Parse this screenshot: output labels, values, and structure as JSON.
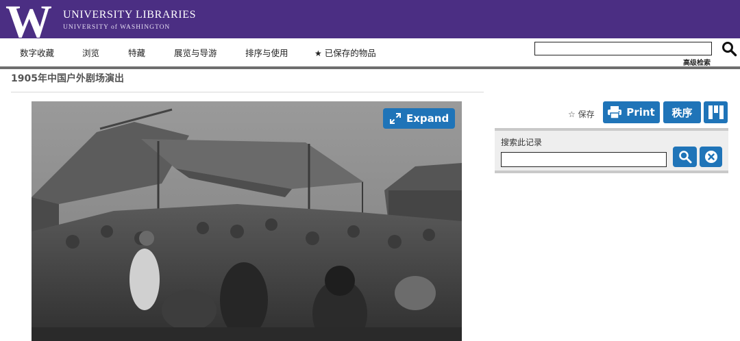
{
  "header": {
    "logo_letter": "W",
    "title": "UNIVERSITY LIBRARIES",
    "subtitle": "UNIVERSITY of WASHINGTON",
    "brand_color": "#4b2e83"
  },
  "nav": {
    "items": [
      {
        "label": "数字收藏"
      },
      {
        "label": "浏览"
      },
      {
        "label": "特藏"
      },
      {
        "label": "展览与导游"
      },
      {
        "label": "排序与使用"
      },
      {
        "label": "已保存的物品",
        "icon": "star-icon"
      }
    ],
    "search": {
      "value": "",
      "placeholder": "",
      "icon": "search-icon"
    },
    "advanced_search": "高级检索"
  },
  "page": {
    "title": "1905年中国户外剧场演出"
  },
  "viewer": {
    "expand_label": "Expand",
    "expand_icon": "expand-arrows-icon",
    "image_subject": "black-and-white photograph"
  },
  "actions": {
    "save_label": "保存",
    "save_icon": "star-outline-icon",
    "print_label": "Print",
    "print_icon": "printer-icon",
    "order_label": "秩序",
    "view_icon": "columns-icon",
    "accent_color": "#1f74b8"
  },
  "record_search": {
    "label": "搜索此记录",
    "value": "",
    "search_icon": "search-icon",
    "clear_icon": "clear-icon"
  }
}
